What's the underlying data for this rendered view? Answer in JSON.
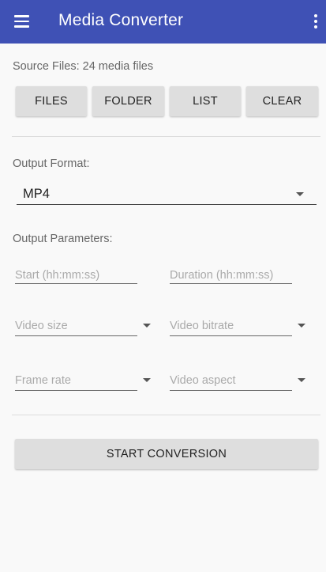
{
  "app_bar": {
    "title": "Media Converter",
    "color": "#3f51b5"
  },
  "source": {
    "label": "Source Files: 24 media files"
  },
  "source_buttons": [
    "FILES",
    "FOLDER",
    "LIST",
    "CLEAR"
  ],
  "output_format": {
    "label": "Output Format:",
    "value": "MP4"
  },
  "output_parameters": {
    "label": "Output Parameters:",
    "start_placeholder": "Start (hh:mm:ss)",
    "duration_placeholder": "Duration (hh:mm:ss)",
    "video_size": "Video size",
    "video_bitrate": "Video bitrate",
    "frame_rate": "Frame rate",
    "video_aspect": "Video aspect"
  },
  "start_button": "START CONVERSION",
  "icons": {
    "menu": "hamburger-menu-icon",
    "overflow": "vertical-dots-icon",
    "dropdown": "triangle-down-icon"
  }
}
